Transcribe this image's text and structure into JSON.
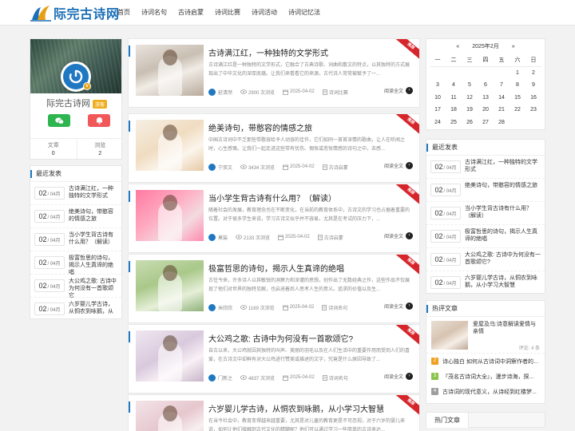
{
  "site": {
    "name": "际完古诗网"
  },
  "nav": [
    "首页",
    "诗词名句",
    "古诗启蒙",
    "诗词比赛",
    "诗词活动",
    "诗词记忆法"
  ],
  "profile": {
    "name": "际完古诗网",
    "badge": "游客",
    "stats": [
      {
        "label": "文章",
        "value": "0"
      },
      {
        "label": "浏览",
        "value": "2"
      }
    ]
  },
  "left_recent": {
    "title": "最近发表",
    "items": [
      {
        "day": "02",
        "month": "/ 04月",
        "title": "古诗满江红，一种独特的文学形式"
      },
      {
        "day": "02",
        "month": "/ 04月",
        "title": "绝美诗句，带憨容的情感之旅"
      },
      {
        "day": "02",
        "month": "/ 04月",
        "title": "当小学生背古诗有什么用？（解读）"
      },
      {
        "day": "02",
        "month": "/ 04月",
        "title": "极富哲思的诗句，揭示人生真谛的绝唱"
      },
      {
        "day": "02",
        "month": "/ 04月",
        "title": "大公鸡之歌: 古诗中为何没有一首歌颂它"
      },
      {
        "day": "02",
        "month": "/ 04月",
        "title": "六岁婴儿学古诗，从恫农到咏鹅，从"
      }
    ]
  },
  "ribbon_label": "推荐",
  "read_more": "阅读全文",
  "articles": [
    {
      "title": "古诗满江红，一种独特的文学形式",
      "excerpt": "古诗满江红是一种独特的文学形式，它融合了古典诗歌、词曲和散文的特点，以其独特的方式展现出了中华文化的深厚底蕴。让我们来看看它的来源，古代诗人常常被赋予了一...",
      "author": "延清然",
      "views": "2900 次浏览",
      "date": "2025-04-02",
      "category": "诗词比赛"
    },
    {
      "title": "绝美诗句，带憨容的情感之旅",
      "excerpt": "中国古诗词中不乏那些带憨容给予人动容的佳作，它们如同一首首深情的歌曲，让人在听闻之时，心生感慨。让我们一起走进这些带有忧伤、惆怅或悲怅情感的诗句之中，去感...",
      "author": "宁双文",
      "views": "3434 次浏览",
      "date": "2025-04-02",
      "category": "古诗启蒙"
    },
    {
      "title": "当小学生背古诗有什么用？（解读）",
      "excerpt": "随着社会的发展，教育理念也在不断变化，在当前的教育体系中，古诗文的学习也占据着重要的位置。对于很多学生来说，学习古诗文似乎并不容易，尤其是在考试的压力下，...",
      "author": "莫装",
      "views": "2133 次浏览",
      "date": "2025-04-02",
      "category": "古诗启蒙"
    },
    {
      "title": "极富哲思的诗句，揭示人生真谛的绝唱",
      "excerpt": "古往今来，许多诗人以其敏锐的洞察力和深邃的思想，创作出了无数经典之作，这些作品不仅展现了他们对世界的独特见解，也启迪着后人思考人生的意义。追求的价值以及生...",
      "author": "米欣欣",
      "views": "1169 次浏览",
      "date": "2025-04-02",
      "category": "诗词名句"
    },
    {
      "title": "大公鸡之歌: 古诗中为何没有一首歌颂它?",
      "excerpt": "自古以来，大公鸡就因其独特的叫声、美丽的羽毛以及在人们生活中的重要作用而受到人们的喜爱，在古诗文中却鲜有对大公鸡进行赞美或描述的文字，究竟是什么原因导致了...",
      "author": "门新之",
      "views": "4837 次浏览",
      "date": "2025-04-02",
      "category": "诗词名句"
    },
    {
      "title": "六岁婴儿学古诗，从恫农到咏鹅，从小学习大智慧",
      "excerpt": "在当今社会中，教育变得越来越重要，尤其是对儿童的教育更是不可忽视，对于六岁的婴儿来说，如何让他们接触到古代文化的精髓呢？他们可以通过学习一些简单的古诗来达...",
      "author": "",
      "views": "",
      "date": "",
      "category": ""
    }
  ],
  "calendar": {
    "prev": "«",
    "title": "2025年2月",
    "next": "»",
    "weekdays": [
      "一",
      "二",
      "三",
      "四",
      "五",
      "六",
      "日"
    ],
    "days": [
      "",
      "",
      "",
      "",
      "",
      "1",
      "2",
      "3",
      "4",
      "5",
      "6",
      "7",
      "8",
      "9",
      "10",
      "11",
      "12",
      "13",
      "14",
      "15",
      "16",
      "17",
      "18",
      "19",
      "20",
      "21",
      "22",
      "23",
      "24",
      "25",
      "26",
      "27",
      "28",
      "",
      ""
    ]
  },
  "right_recent": {
    "title": "最近发表",
    "items": [
      {
        "day": "02",
        "month": "/ 04月",
        "title": "古诗满江红，一种独特的文学形式"
      },
      {
        "day": "02",
        "month": "/ 04月",
        "title": "绝美诗句，带憨容的情感之旅"
      },
      {
        "day": "02",
        "month": "/ 04月",
        "title": "当小学生背古诗有什么用？（解读）"
      },
      {
        "day": "02",
        "month": "/ 04月",
        "title": "极富哲思的诗句，揭示人生真谛的绝唱"
      },
      {
        "day": "02",
        "month": "/ 04月",
        "title": "大公鸡之歌: 古诗中为何没有一首歌颂它?"
      },
      {
        "day": "02",
        "month": "/ 04月",
        "title": "六岁婴儿学古诗，从恫农到咏鹅，从小学习大智慧"
      }
    ]
  },
  "hot": {
    "title": "热评文章",
    "feature": {
      "title": "爱屋及乌:诗意解读爱情与亲情",
      "comments": "评论: 4 条"
    },
    "items": [
      {
        "num": "2",
        "color": "#f0a020",
        "title": "诗心独白 如何从古诗词中洞察作者的..."
      },
      {
        "num": "3",
        "color": "#8bc34a",
        "title": "『茂名古诗词大全』，漫步诗海，探..."
      },
      {
        "num": "4",
        "color": "#9e9e9e",
        "title": "古诗词的现代意义，从诗经到红楼梦..."
      }
    ]
  },
  "tabs": [
    "热门文章",
    ""
  ]
}
